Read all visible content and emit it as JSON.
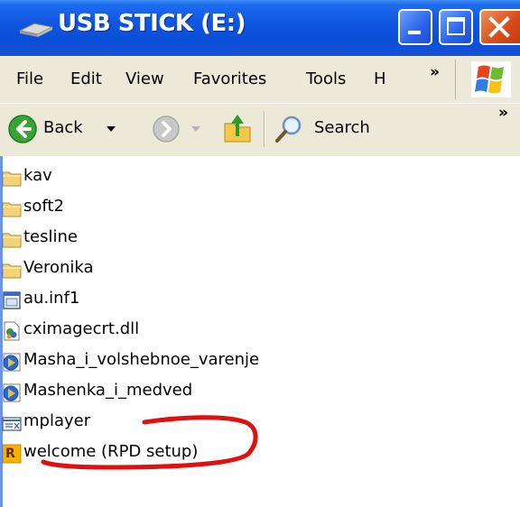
{
  "window": {
    "title": "USB STICK (E:)",
    "title_icon": "usb-drive-icon",
    "controls": [
      "minimize-icon",
      "maximize-icon",
      "close-icon"
    ]
  },
  "menu": {
    "items": [
      "File",
      "Edit",
      "View",
      "Favorites",
      "Tools",
      "H"
    ],
    "overflow": "»",
    "logo": "windows-logo-icon"
  },
  "toolbar": {
    "back_label": "Back",
    "search_label": "Search",
    "overflow": "»",
    "icons": [
      "back-arrow-icon",
      "forward-arrow-icon",
      "up-folder-icon",
      "search-icon"
    ]
  },
  "files": [
    {
      "name": "kav",
      "type": "folder"
    },
    {
      "name": "soft2",
      "type": "folder"
    },
    {
      "name": "tesline",
      "type": "folder"
    },
    {
      "name": "Veronika",
      "type": "folder"
    },
    {
      "name": "au.inf1",
      "type": "inf-file"
    },
    {
      "name": "cximagecrt.dll",
      "type": "dll-file"
    },
    {
      "name": "Masha_i_volshebnoe_varenje",
      "type": "media-file"
    },
    {
      "name": "Mashenka_i_medved",
      "type": "media-file"
    },
    {
      "name": "mplayer",
      "type": "exe-file"
    },
    {
      "name": "welcome (RPD setup)",
      "type": "rpd-setup-file"
    }
  ],
  "colors": {
    "titlebar": "#0a4fd8",
    "chrome": "#ece9d8",
    "close_button": "#d64b1a",
    "annotation": "#e01010",
    "folder": "#f3d37a"
  }
}
